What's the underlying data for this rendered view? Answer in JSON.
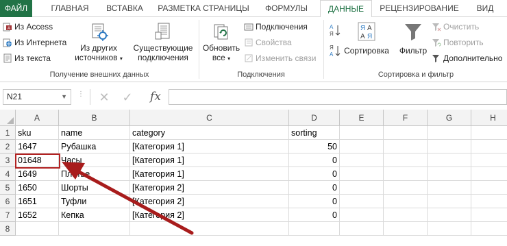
{
  "tabs": [
    {
      "label": "ФАЙЛ"
    },
    {
      "label": "ГЛАВНАЯ"
    },
    {
      "label": "ВСТАВКА"
    },
    {
      "label": "РАЗМЕТКА СТРАНИЦЫ"
    },
    {
      "label": "ФОРМУЛЫ"
    },
    {
      "label": "ДАННЫЕ"
    },
    {
      "label": "РЕЦЕНЗИРОВАНИЕ"
    },
    {
      "label": "ВИД"
    }
  ],
  "active_tab": "ДАННЫЕ",
  "ribbon": {
    "get_external": {
      "from_access": "Из Access",
      "from_web": "Из Интернета",
      "from_text": "Из текста",
      "from_other": "Из других",
      "from_other_2": "источников",
      "existing": "Существующие",
      "existing_2": "подключения",
      "group_label": "Получение внешних данных"
    },
    "connections": {
      "refresh": "Обновить",
      "refresh_2": "все",
      "connections": "Подключения",
      "properties": "Свойства",
      "edit_links": "Изменить связи",
      "group_label": "Подключения"
    },
    "sort_filter": {
      "sort": "Сортировка",
      "filter": "Фильтр",
      "clear": "Очистить",
      "reapply": "Повторить",
      "advanced": "Дополнительно",
      "group_label": "Сортировка и фильтр"
    }
  },
  "formula_bar": {
    "name_box": "N21",
    "fx": "fx",
    "value": ""
  },
  "grid": {
    "columns": [
      "A",
      "B",
      "C",
      "D",
      "E",
      "F",
      "G",
      "H"
    ],
    "rows": [
      {
        "num": "1",
        "cells": [
          "sku",
          "name",
          "category",
          "sorting"
        ]
      },
      {
        "num": "2",
        "cells": [
          "1647",
          "Рубашка",
          "[Категория 1]",
          "50"
        ]
      },
      {
        "num": "3",
        "cells": [
          "01648",
          "Часы",
          "[Категория 1]",
          "0"
        ]
      },
      {
        "num": "4",
        "cells": [
          "1649",
          "Платье",
          "[Категория 1]",
          "0"
        ]
      },
      {
        "num": "5",
        "cells": [
          "1650",
          "Шорты",
          "[Категория 2]",
          "0"
        ]
      },
      {
        "num": "6",
        "cells": [
          "1651",
          "Туфли",
          "[Категория 2]",
          "0"
        ]
      },
      {
        "num": "7",
        "cells": [
          "1652",
          "Кепка",
          "[Категория 2]",
          "0"
        ]
      },
      {
        "num": "8",
        "cells": [
          "",
          "",
          "",
          ""
        ]
      }
    ]
  },
  "colors": {
    "excel_green": "#217346",
    "annotation_red": "#a81c1c",
    "header_bg": "#f3f3f3"
  }
}
